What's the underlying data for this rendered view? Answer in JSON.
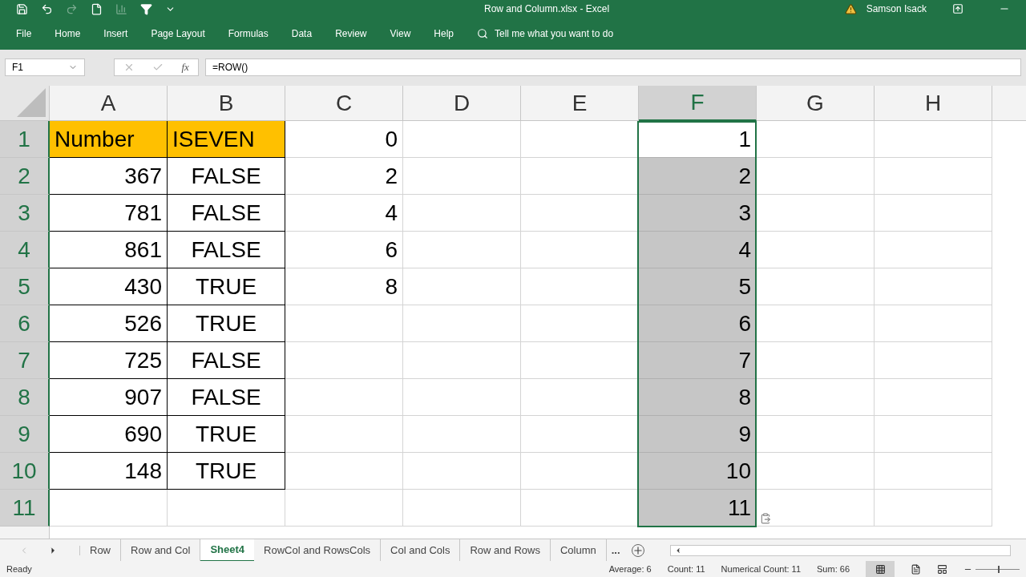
{
  "window": {
    "title": "Row and Column.xlsx  -  Excel",
    "user": "Samson Isack"
  },
  "ribbon_tabs": [
    "File",
    "Home",
    "Insert",
    "Page Layout",
    "Formulas",
    "Data",
    "Review",
    "View",
    "Help"
  ],
  "tell_me": {
    "placeholder": "Tell me what you want to do"
  },
  "formula_bar": {
    "name_box": "F1",
    "function_label": "fx",
    "formula": "=ROW()"
  },
  "columns": [
    {
      "label": "A",
      "selected": false
    },
    {
      "label": "B",
      "selected": false
    },
    {
      "label": "C",
      "selected": false
    },
    {
      "label": "D",
      "selected": false
    },
    {
      "label": "E",
      "selected": false
    },
    {
      "label": "F",
      "selected": true
    },
    {
      "label": "G",
      "selected": false
    },
    {
      "label": "H",
      "selected": false
    }
  ],
  "rows": [
    {
      "label": "1",
      "selected": true,
      "active": true,
      "kind": "header",
      "col_a": "Number",
      "col_b": "ISEVEN",
      "col_c": "0",
      "col_f": "1"
    },
    {
      "label": "2",
      "selected": true,
      "active": false,
      "kind": "data",
      "col_a": "367",
      "col_b": "FALSE",
      "col_c": "2",
      "col_f": "2"
    },
    {
      "label": "3",
      "selected": true,
      "active": false,
      "kind": "data",
      "col_a": "781",
      "col_b": "FALSE",
      "col_c": "4",
      "col_f": "3"
    },
    {
      "label": "4",
      "selected": true,
      "active": false,
      "kind": "data",
      "col_a": "861",
      "col_b": "FALSE",
      "col_c": "6",
      "col_f": "4"
    },
    {
      "label": "5",
      "selected": true,
      "active": false,
      "kind": "data",
      "col_a": "430",
      "col_b": "TRUE",
      "col_c": "8",
      "col_f": "5"
    },
    {
      "label": "6",
      "selected": true,
      "active": false,
      "kind": "data",
      "col_a": "526",
      "col_b": "TRUE",
      "col_f": "6"
    },
    {
      "label": "7",
      "selected": true,
      "active": false,
      "kind": "data",
      "col_a": "725",
      "col_b": "FALSE",
      "col_f": "7"
    },
    {
      "label": "8",
      "selected": true,
      "active": false,
      "kind": "data",
      "col_a": "907",
      "col_b": "FALSE",
      "col_f": "8"
    },
    {
      "label": "9",
      "selected": true,
      "active": false,
      "kind": "data",
      "col_a": "690",
      "col_b": "TRUE",
      "col_f": "9"
    },
    {
      "label": "10",
      "selected": true,
      "active": false,
      "kind": "data",
      "col_a": "148",
      "col_b": "TRUE",
      "col_f": "10"
    },
    {
      "label": "11",
      "selected": true,
      "active": false,
      "kind": "empty",
      "col_f": "11"
    }
  ],
  "sheet_tabs": [
    {
      "label": "Row",
      "selected": false
    },
    {
      "label": "Row and Col",
      "selected": false
    },
    {
      "label": "Sheet4",
      "selected": true
    },
    {
      "label": "RowCol and RowsCols",
      "selected": false
    },
    {
      "label": "Col and Cols",
      "selected": false
    },
    {
      "label": "Row and Rows",
      "selected": false
    },
    {
      "label": "Column",
      "selected": false
    }
  ],
  "more_tabs": "...",
  "status_bar": {
    "state": "Ready",
    "stats": [
      "Average: 6",
      "Count: 11",
      "Numerical Count: 11",
      "Sum: 66"
    ],
    "zoom": {
      "level": 0.5
    }
  }
}
